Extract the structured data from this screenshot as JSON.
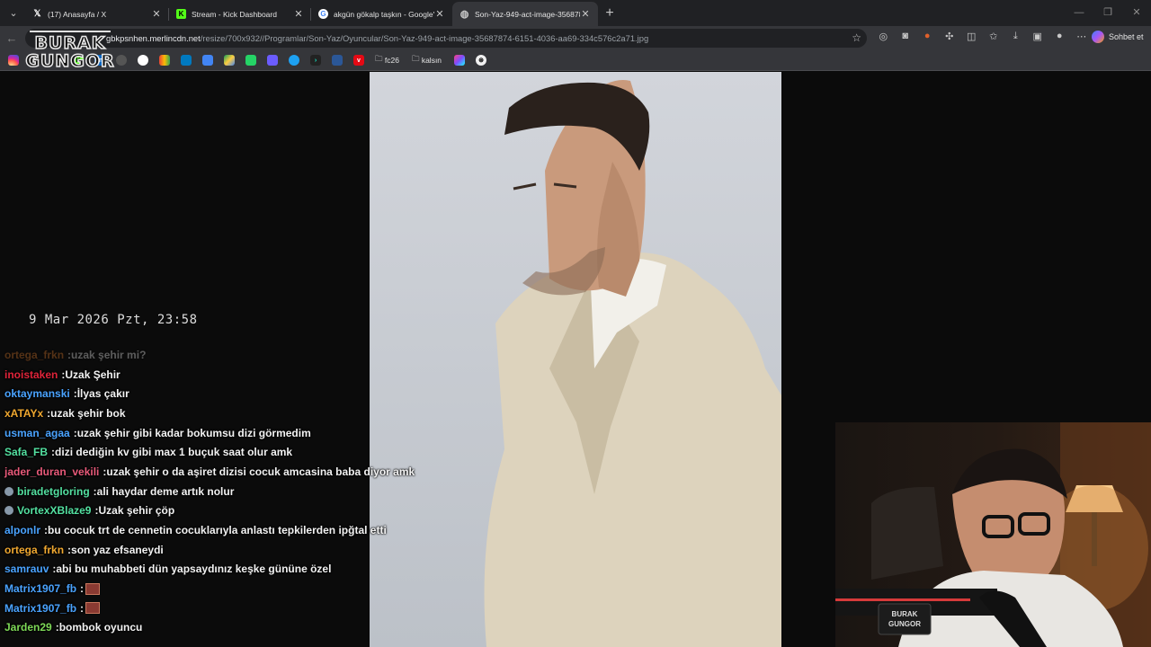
{
  "tabs": [
    {
      "title": "(17) Anasayfa / X",
      "icon": "x-logo-icon",
      "active": false
    },
    {
      "title": "Stream - Kick Dashboard",
      "icon": "kick-logo-icon",
      "active": false
    },
    {
      "title": "akgün gökalp taşkın - Google'da Ara",
      "icon": "google-logo-icon",
      "active": false
    },
    {
      "title": "Son-Yaz-949-act-image-35687874-6151-4036-aa69-334c576c2a71.jpg",
      "icon": "globe-icon",
      "active": true
    }
  ],
  "address": {
    "host": "gbkpsnhen.merlincdn.net",
    "path": "/resize/700x932//Programlar/Son-Yaz/Oyuncular/Son-Yaz-949-act-image-35687874-6151-4036-aa69-334c576c2a71.jpg"
  },
  "copilot_label": "Sohbet et",
  "bookmark_folders": [
    "fc26",
    "kalsın"
  ],
  "logo": {
    "line1": "BURAK",
    "line2": "GUNGOR"
  },
  "overlay": {
    "datetime": "9 Mar 2026 Pzt, 23:58"
  },
  "chat": [
    {
      "user": "ortega_frkn",
      "color": "#e07b2c",
      "text": "uzak şehir mi?",
      "faded": true
    },
    {
      "user": "inoistaken",
      "color": "#e0243a",
      "text": "Uzak Şehir"
    },
    {
      "user": "oktaymanski",
      "color": "#4aa3ff",
      "text": "İlyas çakır"
    },
    {
      "user": "xATAYx",
      "color": "#f0a830",
      "text": "uzak şehir bok"
    },
    {
      "user": "usman_agaa",
      "color": "#4aa3ff",
      "text": "uzak şehir gibi kadar bokumsu dizi görmedim"
    },
    {
      "user": "Safa_FB",
      "color": "#53e0a0",
      "text": "dizi dediğin kv gibi max 1 buçuk saat olur amk"
    },
    {
      "user": "jader_duran_vekili",
      "color": "#e85a7a",
      "text": "uzak şehir o da aşiret dizisi cocuk amcasina baba diyor amk"
    },
    {
      "user": "biradetgloring",
      "color": "#53e0a0",
      "text": "ali haydar deme artık nolur",
      "badge": true
    },
    {
      "user": "VortexXBlaze9",
      "color": "#53e0a0",
      "text": "Uzak şehir çöp",
      "badge": true
    },
    {
      "user": "alponlr",
      "color": "#4aa3ff",
      "text": "bu cocuk trt de cennetin cocuklarıyla anlastı tepkilerden ipğtal etti"
    },
    {
      "user": "ortega_frkn",
      "color": "#f0a830",
      "text": "son yaz efsaneydi"
    },
    {
      "user": "samrauv",
      "color": "#4aa3ff",
      "text": "abi bu muhabbeti dün yapsaydınız keşke gününe özel"
    },
    {
      "user": "Matrix1907_fb",
      "color": "#4aa3ff",
      "text": "",
      "emote": true
    },
    {
      "user": "Matrix1907_fb",
      "color": "#4aa3ff",
      "text": "",
      "emote": true
    },
    {
      "user": "Jarden29",
      "color": "#7ed957",
      "text": "bombok oyuncu"
    }
  ]
}
